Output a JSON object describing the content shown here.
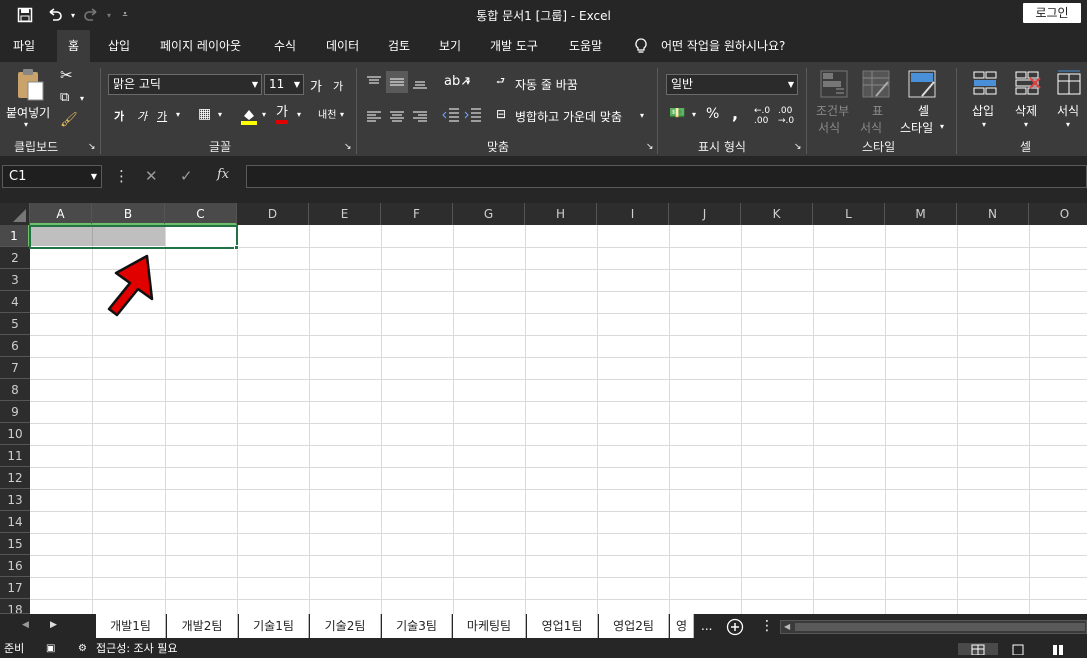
{
  "window": {
    "title": "통합 문서1  [그룹]  -  Excel",
    "login_label": "로그인",
    "quick_access": [
      "save-icon",
      "undo-icon",
      "redo-icon",
      "customize-icon"
    ]
  },
  "tabs": [
    "파일",
    "홈",
    "삽입",
    "페이지 레이아웃",
    "수식",
    "데이터",
    "검토",
    "보기",
    "개발 도구",
    "도움말"
  ],
  "tell_me": "어떤 작업을 원하시나요?",
  "ribbon": {
    "clipboard": {
      "paste": "붙여넣기",
      "label": "클립보드"
    },
    "font": {
      "name": "맑은 고딕",
      "size": "11",
      "grow": "가",
      "shrink": "가",
      "bold": "가",
      "italic": "가",
      "underline": "가",
      "color_a": "가",
      "phonetic": "내천",
      "label": "글꼴"
    },
    "alignment": {
      "wrap": "자동 줄 바꿈",
      "merge": "병합하고 가운데 맞춤",
      "label": "맞춤"
    },
    "number": {
      "format": "일반",
      "percent": "%",
      "comma": ",",
      "label": "표시 형식"
    },
    "styles": {
      "conditional": "조건부\n서식",
      "conditional_l1": "조건부",
      "conditional_l2": "서식",
      "table_l1": "표",
      "table_l2": "서식",
      "cell_l1": "셀",
      "cell_l2": "스타일",
      "label": "스타일"
    },
    "cells": {
      "insert": "삽입",
      "delete": "삭제",
      "format": "서식",
      "label": "셀"
    }
  },
  "formula_bar": {
    "name_box": "C1",
    "cancel": "✕",
    "enter": "✓",
    "fx": "fx",
    "value": ""
  },
  "grid": {
    "columns": [
      "A",
      "B",
      "C",
      "D",
      "E",
      "F",
      "G",
      "H",
      "I",
      "J",
      "K",
      "L",
      "M",
      "N",
      "O"
    ],
    "rows": [
      "1",
      "2",
      "3",
      "4",
      "5",
      "6",
      "7",
      "8",
      "9",
      "10",
      "11",
      "12",
      "13",
      "14",
      "15",
      "16",
      "17",
      "18"
    ],
    "selected_cell": "C1"
  },
  "sheets": [
    "개발1팀",
    "개발2팀",
    "기술1팀",
    "기술2팀",
    "기술3팀",
    "마케팅팀",
    "영업1팀",
    "영업2팀",
    "영"
  ],
  "sheet_more": "...",
  "status": {
    "ready": "준비",
    "accessibility": "접근성: 조사 필요"
  },
  "colors": {
    "accent_green": "#217346",
    "arrow_red": "#e00000",
    "selection_fill": "#bfbfbf"
  }
}
